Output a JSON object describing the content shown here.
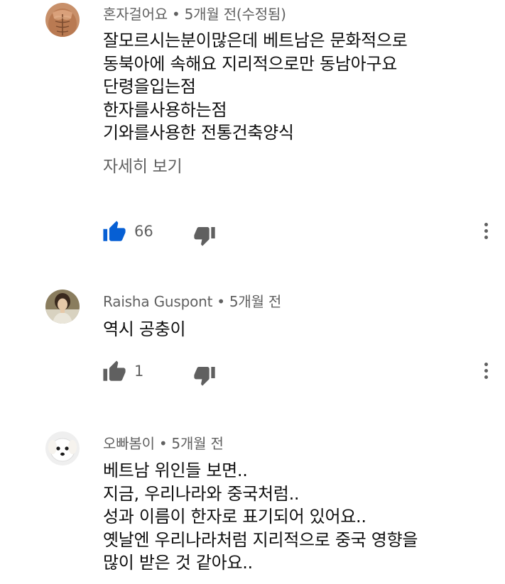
{
  "accent_color": "#065fd4",
  "muted_color": "#606060",
  "comments": [
    {
      "author": "혼자걸어요",
      "time": "5개월 전(수정됨)",
      "avatar_icon": "muscular-torso-avatar",
      "lines": [
        "잘모르시는분이많은데 베트남은 문화적으로",
        "동북아에 속해요 지리적으로만 동남아구요",
        "단령을입는점",
        "한자를사용하는점",
        "기와를사용한 전통건축양식"
      ],
      "read_more": "자세히 보기",
      "likes": "66",
      "liked": true
    },
    {
      "author": "Raisha Guspont",
      "time": "5개월 전",
      "avatar_icon": "portrait-woman-avatar",
      "lines": [
        "역시 공충이"
      ],
      "likes": "1",
      "liked": false
    },
    {
      "author": "오빠봄이",
      "time": "5개월 전",
      "avatar_icon": "white-dog-avatar",
      "lines": [
        "베트남 위인들 보면..",
        "지금, 우리나라와 중국처럼..",
        "성과 이름이 한자로 표기되어 있어요..",
        "옛날엔 우리나라처럼 지리적으로 중국 영향을",
        "많이 받은 것 같아요.."
      ]
    }
  ],
  "meta_separator": "•"
}
